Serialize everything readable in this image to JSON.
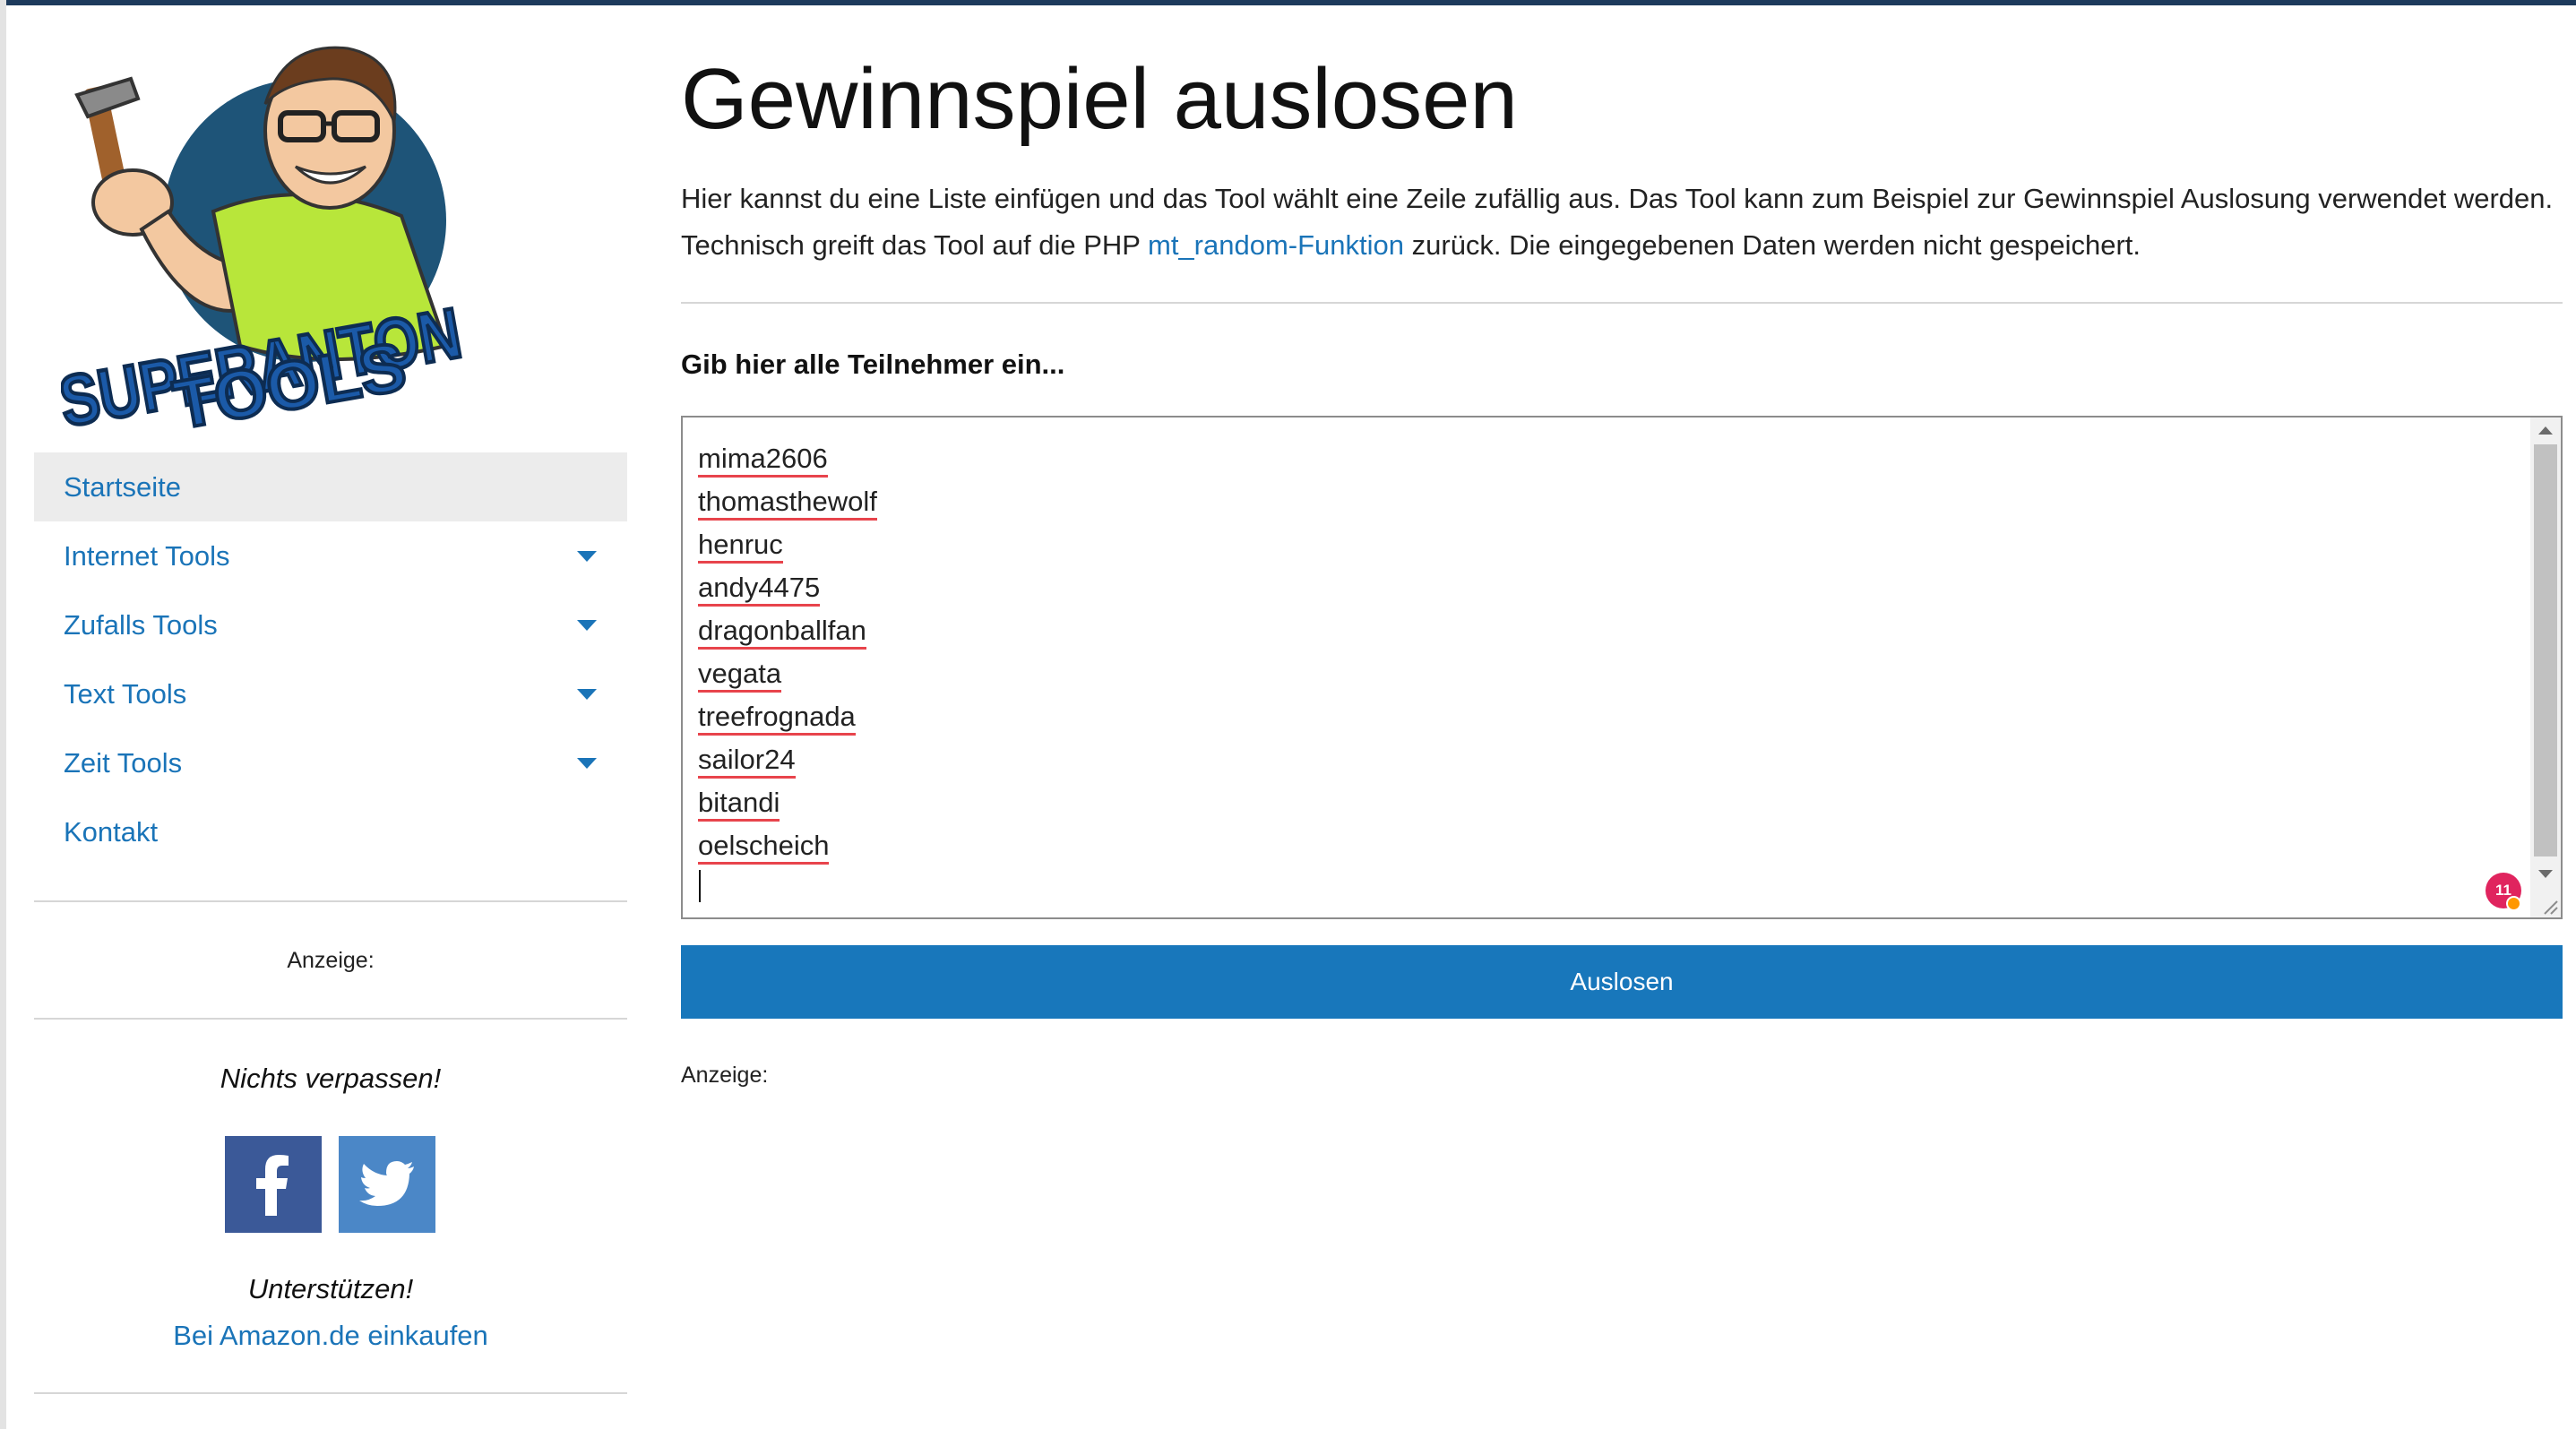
{
  "logo": {
    "text_line1": "SUPERANTON",
    "text_line2": "TOOLS"
  },
  "sidebar": {
    "nav": [
      {
        "label": "Startseite",
        "active": true,
        "has_submenu": false
      },
      {
        "label": "Internet Tools",
        "active": false,
        "has_submenu": true
      },
      {
        "label": "Zufalls Tools",
        "active": false,
        "has_submenu": true
      },
      {
        "label": "Text Tools",
        "active": false,
        "has_submenu": true
      },
      {
        "label": "Zeit Tools",
        "active": false,
        "has_submenu": true
      },
      {
        "label": "Kontakt",
        "active": false,
        "has_submenu": false
      }
    ],
    "ad_label": "Anzeige:",
    "follow_title": "Nichts verpassen!",
    "social": {
      "facebook_icon": "facebook-icon",
      "twitter_icon": "twitter-icon"
    },
    "support_title": "Unterstützen!",
    "amazon_link": "Bei Amazon.de einkaufen"
  },
  "main": {
    "title": "Gewinnspiel auslosen",
    "intro_part1": "Hier kannst du eine Liste einfügen und das Tool wählt eine Zeile zufällig aus. Das Tool kann zum Beispiel zur Gewinnspiel Auslosung verwendet werden. Technisch greift das Tool auf die PHP ",
    "intro_link": "mt_random-Funktion",
    "intro_part2": " zurück. Die eingegebenen Daten werden nicht gespeichert.",
    "input_label": "Gib hier alle Teilnehmer ein...",
    "participants": [
      "mima2606",
      "thomasthewolf",
      "henruc",
      "andy4475",
      "dragonballfan",
      "vegata",
      "treefrognada",
      "sailor24",
      "bitandi",
      "oelscheich"
    ],
    "spellcheck_badge": "11",
    "button_label": "Auslosen",
    "ad_label": "Anzeige:"
  },
  "colors": {
    "link": "#1a74b8",
    "button": "#1877bb",
    "topbar": "#1d3a5c",
    "spell_underline": "#e8444c"
  }
}
